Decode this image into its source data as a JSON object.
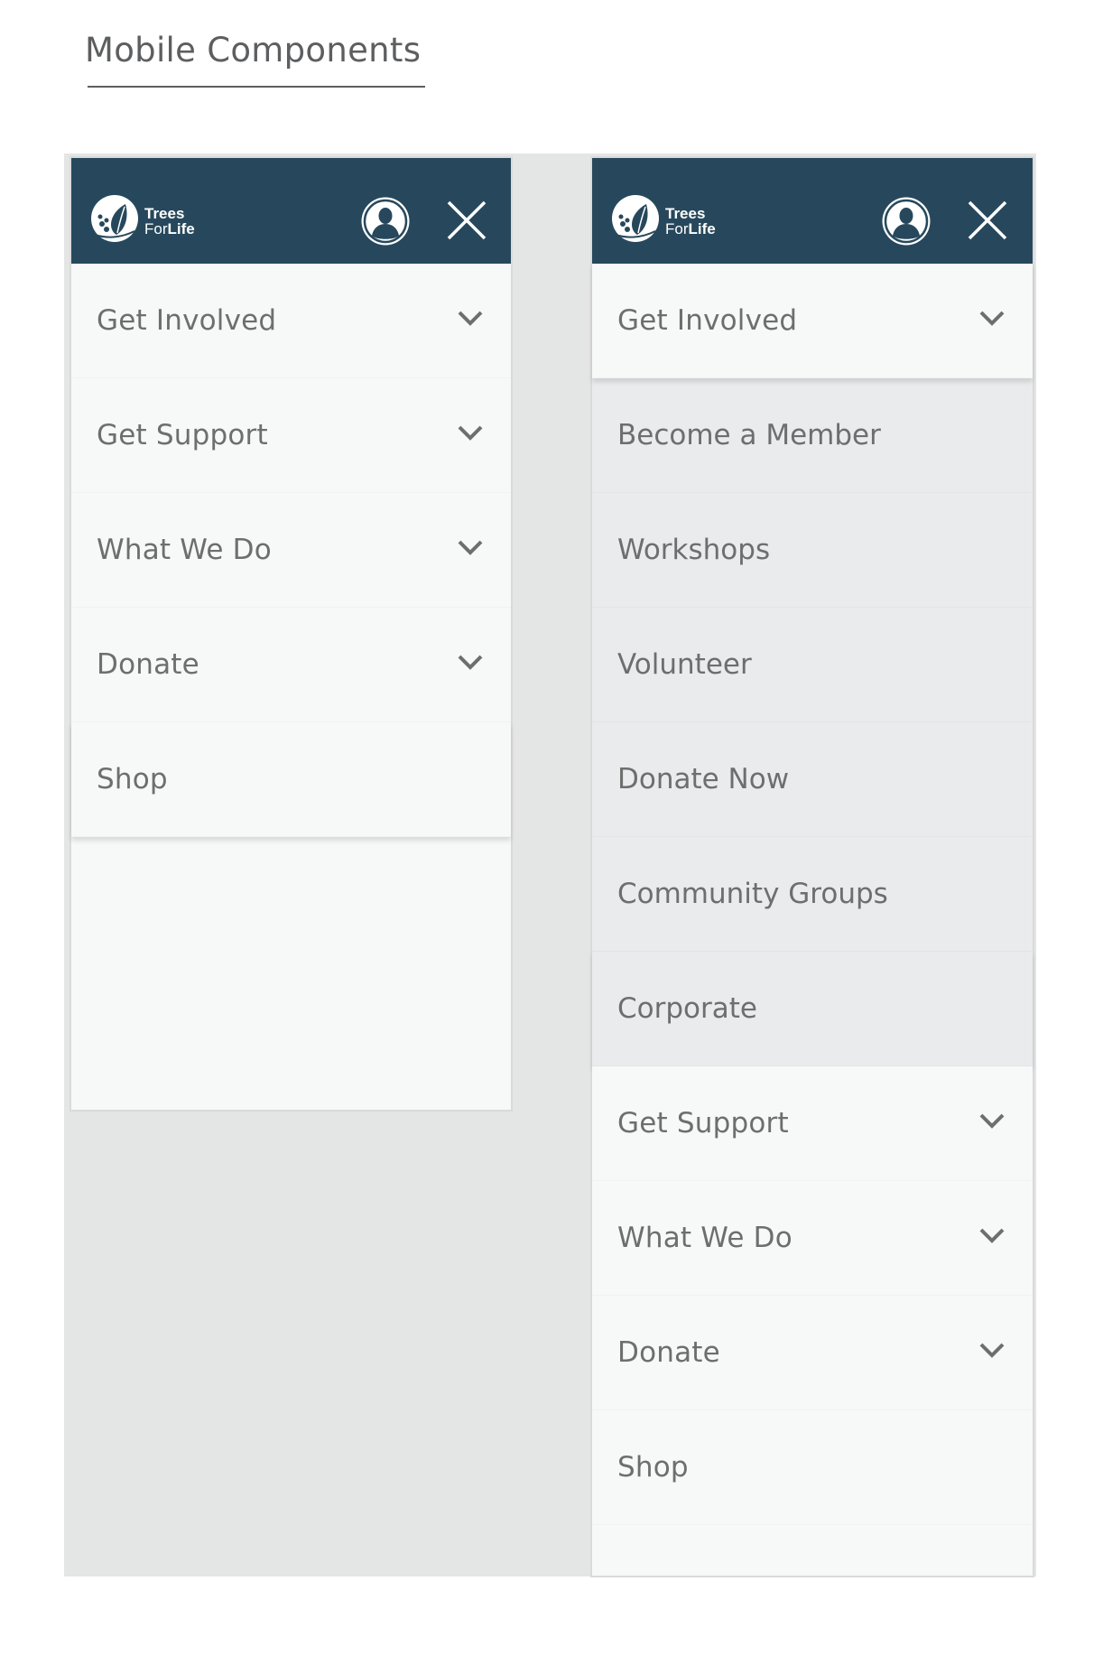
{
  "page": {
    "title": "Mobile Components"
  },
  "brand": {
    "line1": "Trees",
    "line2a": "For",
    "line2b": "Life",
    "header_color": "#27485c"
  },
  "left_menu": {
    "items": [
      {
        "label": "Get Involved",
        "has_dropdown": true
      },
      {
        "label": "Get Support",
        "has_dropdown": true
      },
      {
        "label": "What We Do",
        "has_dropdown": true
      },
      {
        "label": "Donate",
        "has_dropdown": true
      },
      {
        "label": "Shop",
        "has_dropdown": false
      }
    ]
  },
  "right_menu": {
    "expanded": {
      "label": "Get Involved"
    },
    "submenu": [
      {
        "label": "Become a Member"
      },
      {
        "label": "Workshops"
      },
      {
        "label": "Volunteer"
      },
      {
        "label": "Donate Now"
      },
      {
        "label": "Community Groups"
      },
      {
        "label": "Corporate"
      }
    ],
    "items": [
      {
        "label": "Get Support",
        "has_dropdown": true
      },
      {
        "label": "What We Do",
        "has_dropdown": true
      },
      {
        "label": "Donate",
        "has_dropdown": true
      },
      {
        "label": "Shop",
        "has_dropdown": false
      }
    ]
  },
  "icons": {
    "avatar": "user-avatar-icon",
    "close": "close-icon",
    "chevron": "chevron-down-icon",
    "logo": "tree-leaf-logo"
  }
}
